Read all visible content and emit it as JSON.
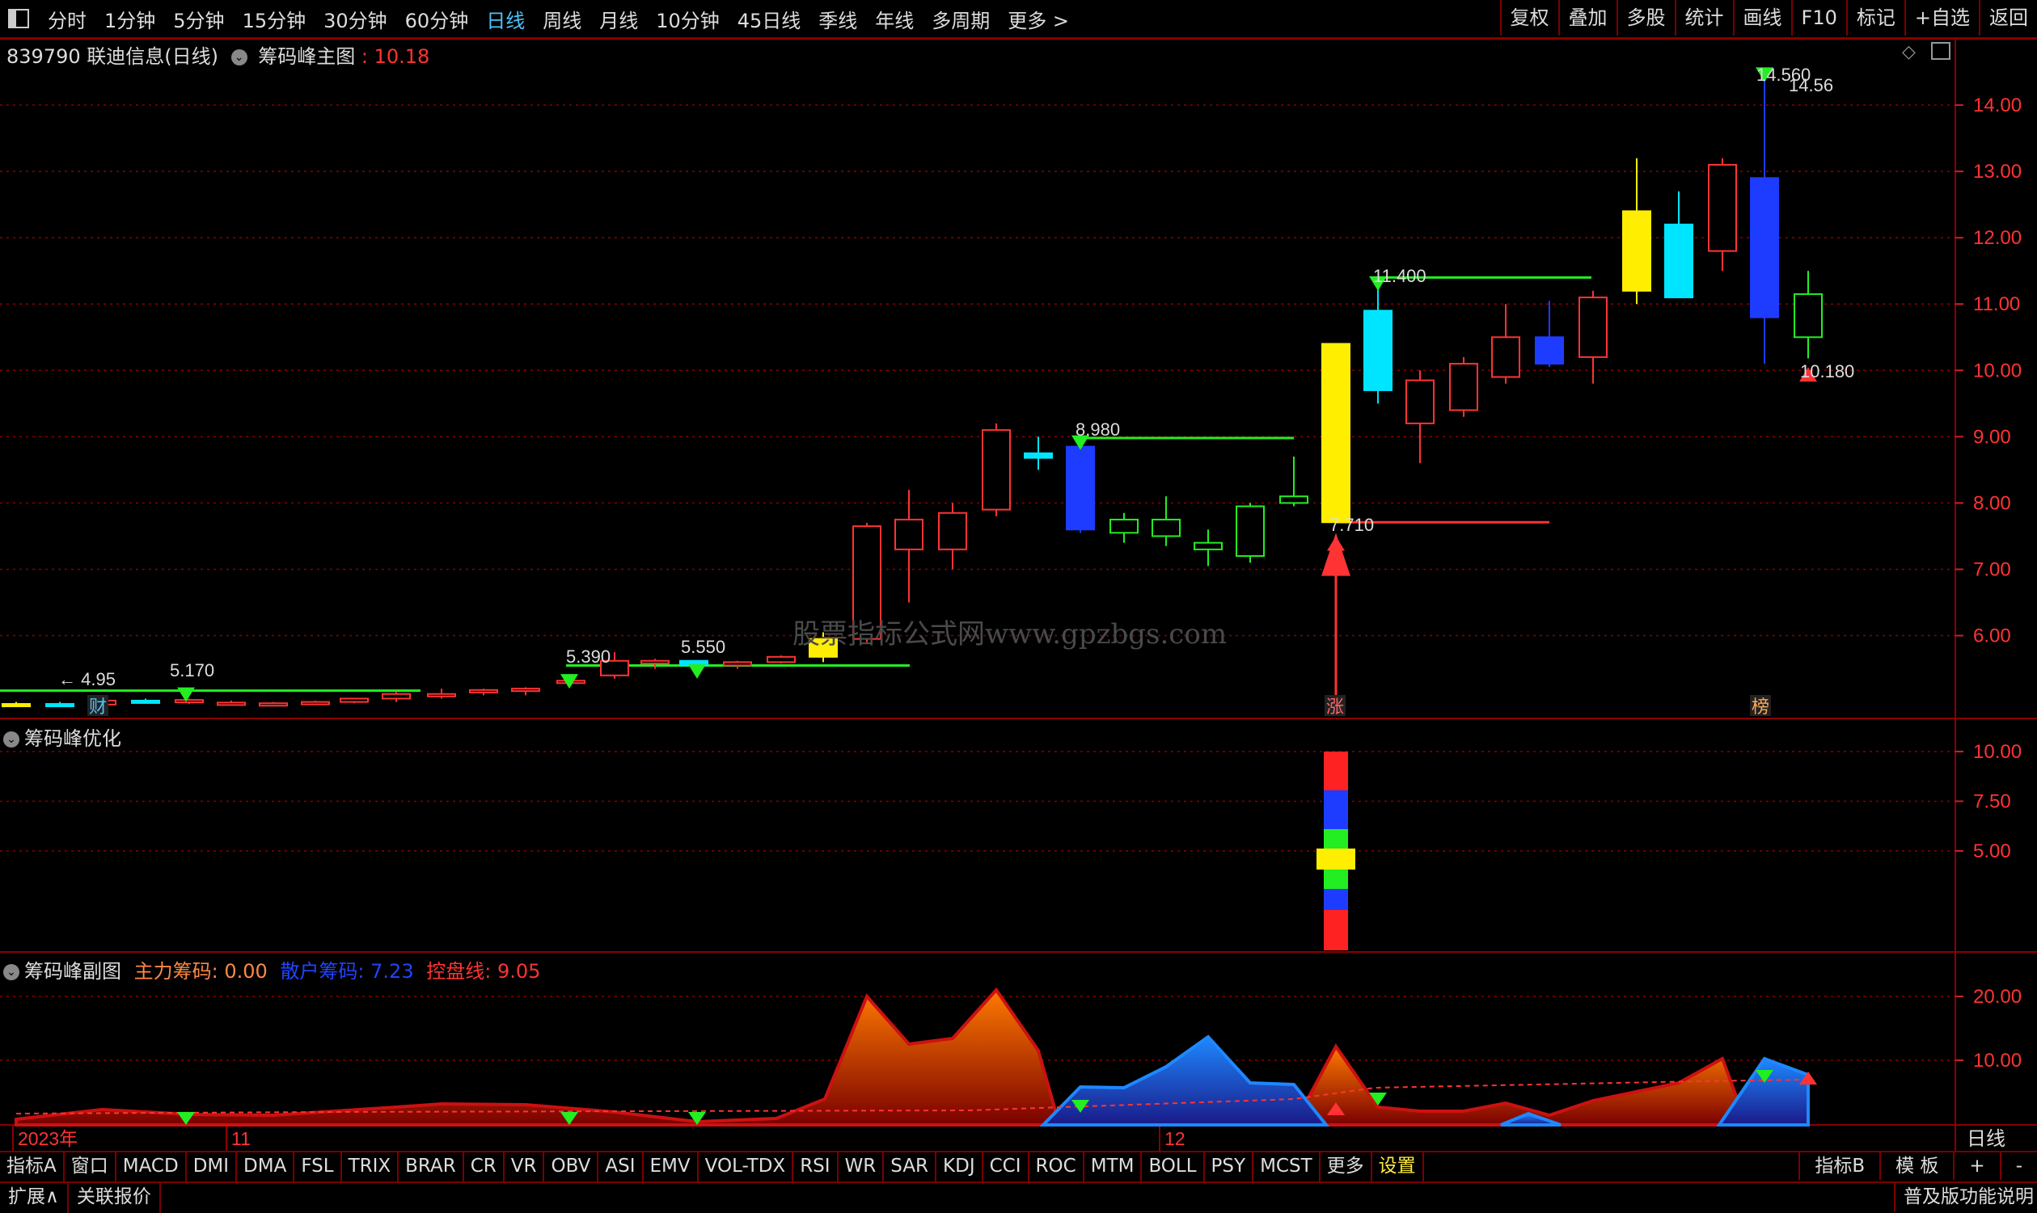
{
  "topbar": {
    "periods": [
      "分时",
      "1分钟",
      "5分钟",
      "15分钟",
      "30分钟",
      "60分钟",
      "日线",
      "周线",
      "月线",
      "10分钟",
      "45日线",
      "季线",
      "年线",
      "多周期",
      "更多 >"
    ],
    "active_period": "日线",
    "right_buttons": [
      "复权",
      "叠加",
      "多股",
      "统计",
      "画线",
      "F10",
      "标记",
      "+自选",
      "返回"
    ]
  },
  "main_panel": {
    "stock": "839790 联迪信息(日线)",
    "indicator": "筹码峰主图",
    "value": ": 10.18",
    "watermark": "股票指标公式网www.gpzbgs.com",
    "y_ticks": [
      "14.00",
      "13.00",
      "12.00",
      "11.00",
      "10.00",
      "9.00",
      "8.00",
      "7.00",
      "6.00"
    ],
    "annotations": [
      "14.560",
      "14.56",
      "11.400",
      "8.980",
      "7.710",
      "10.180",
      "5.550",
      "5.390",
      "5.170",
      "← 4.95"
    ],
    "badges": {
      "cai": "财",
      "zhang": "涨",
      "bang": "榜"
    }
  },
  "mid_panel": {
    "title": "筹码峰优化",
    "y_ticks": [
      "10.00",
      "7.50",
      "5.00"
    ]
  },
  "sub_panel": {
    "title": "筹码峰副图",
    "main_label": "主力筹码: 0.00",
    "retail_label": "散户筹码: 7.23",
    "control_label": "控盘线: 9.05",
    "y_ticks": [
      "20.00",
      "10.00"
    ],
    "x_labels": [
      "2023年",
      "11",
      "12"
    ],
    "period_label": "日线"
  },
  "colors": {
    "up": "#ff3333",
    "down_blue": "#1e3cff",
    "accent_yellow": "#ffee00",
    "green": "#22ee22",
    "grid": "#8b0000"
  },
  "bottombar": {
    "items": [
      "指标A",
      "窗口",
      "MACD",
      "DMI",
      "DMA",
      "FSL",
      "TRIX",
      "BRAR",
      "CR",
      "VR",
      "OBV",
      "ASI",
      "EMV",
      "VOL-TDX",
      "RSI",
      "WR",
      "SAR",
      "KDJ",
      "CCI",
      "ROC",
      "MTM",
      "BOLL",
      "PSY",
      "MCST",
      "更多",
      "设置"
    ],
    "right": [
      "指标B",
      "模 板",
      "+",
      "-"
    ]
  },
  "statusbar": {
    "items": [
      "扩展∧",
      "关联报价"
    ],
    "right": "普及版功能说明"
  },
  "chart_data": {
    "type": "candlestick",
    "y_range": [
      5.0,
      15.0
    ],
    "candles": [
      {
        "o": 4.95,
        "h": 5.0,
        "l": 4.93,
        "c": 4.97
      },
      {
        "o": 4.97,
        "h": 5.0,
        "l": 4.94,
        "c": 4.96
      },
      {
        "o": 4.96,
        "h": 5.05,
        "l": 4.95,
        "c": 5.02
      },
      {
        "o": 5.02,
        "h": 5.05,
        "l": 4.98,
        "c": 5.0
      },
      {
        "o": 5.0,
        "h": 5.05,
        "l": 4.97,
        "c": 5.03
      },
      {
        "o": 4.98,
        "h": 5.02,
        "l": 4.95,
        "c": 4.99
      },
      {
        "o": 4.96,
        "h": 5.0,
        "l": 4.94,
        "c": 4.98
      },
      {
        "o": 4.98,
        "h": 5.02,
        "l": 4.96,
        "c": 5.0
      },
      {
        "o": 5.0,
        "h": 5.06,
        "l": 4.98,
        "c": 5.05
      },
      {
        "o": 5.05,
        "h": 5.15,
        "l": 5.0,
        "c": 5.12
      },
      {
        "o": 5.12,
        "h": 5.2,
        "l": 5.05,
        "c": 5.12
      },
      {
        "o": 5.15,
        "h": 5.2,
        "l": 5.1,
        "c": 5.18
      },
      {
        "o": 5.18,
        "h": 5.22,
        "l": 5.1,
        "c": 5.2
      },
      {
        "o": 5.3,
        "h": 5.4,
        "l": 5.25,
        "c": 5.32
      },
      {
        "o": 5.4,
        "h": 5.75,
        "l": 5.35,
        "c": 5.62
      },
      {
        "o": 5.58,
        "h": 5.65,
        "l": 5.5,
        "c": 5.62
      },
      {
        "o": 5.62,
        "h": 5.6,
        "l": 5.5,
        "c": 5.55
      },
      {
        "o": 5.55,
        "h": 5.62,
        "l": 5.5,
        "c": 5.6
      },
      {
        "o": 5.6,
        "h": 5.7,
        "l": 5.58,
        "c": 5.68
      },
      {
        "o": 5.68,
        "h": 6.05,
        "l": 5.6,
        "c": 5.95
      },
      {
        "o": 5.95,
        "h": 7.7,
        "l": 5.9,
        "c": 7.65
      },
      {
        "o": 7.3,
        "h": 8.2,
        "l": 6.5,
        "c": 7.75
      },
      {
        "o": 7.3,
        "h": 8.0,
        "l": 7.0,
        "c": 7.85
      },
      {
        "o": 7.9,
        "h": 9.2,
        "l": 7.8,
        "c": 9.1
      },
      {
        "o": 8.75,
        "h": 9.0,
        "l": 8.5,
        "c": 8.68
      },
      {
        "o": 8.85,
        "h": 8.98,
        "l": 7.55,
        "c": 7.6
      },
      {
        "o": 7.55,
        "h": 7.85,
        "l": 7.4,
        "c": 7.75
      },
      {
        "o": 7.75,
        "h": 8.1,
        "l": 7.35,
        "c": 7.5
      },
      {
        "o": 7.3,
        "h": 7.6,
        "l": 7.05,
        "c": 7.4
      },
      {
        "o": 7.2,
        "h": 8.0,
        "l": 7.1,
        "c": 7.95
      },
      {
        "o": 8.0,
        "h": 8.7,
        "l": 7.95,
        "c": 8.1
      },
      {
        "o": 7.71,
        "h": 10.4,
        "l": 7.71,
        "c": 10.4
      },
      {
        "o": 10.9,
        "h": 11.4,
        "l": 9.5,
        "c": 9.7
      },
      {
        "o": 9.2,
        "h": 10.0,
        "l": 8.6,
        "c": 9.85
      },
      {
        "o": 9.4,
        "h": 10.2,
        "l": 9.3,
        "c": 10.1
      },
      {
        "o": 9.9,
        "h": 11.0,
        "l": 9.8,
        "c": 10.5
      },
      {
        "o": 10.5,
        "h": 11.05,
        "l": 10.05,
        "c": 10.1
      },
      {
        "o": 10.2,
        "h": 11.2,
        "l": 9.8,
        "c": 11.1
      },
      {
        "o": 11.2,
        "h": 13.2,
        "l": 11.0,
        "c": 12.4
      },
      {
        "o": 12.2,
        "h": 12.7,
        "l": 11.1,
        "c": 11.1
      },
      {
        "o": 11.8,
        "h": 13.2,
        "l": 11.5,
        "c": 13.1
      },
      {
        "o": 12.9,
        "h": 14.56,
        "l": 10.1,
        "c": 10.8
      },
      {
        "o": 10.5,
        "h": 11.5,
        "l": 10.18,
        "c": 11.15
      }
    ]
  }
}
